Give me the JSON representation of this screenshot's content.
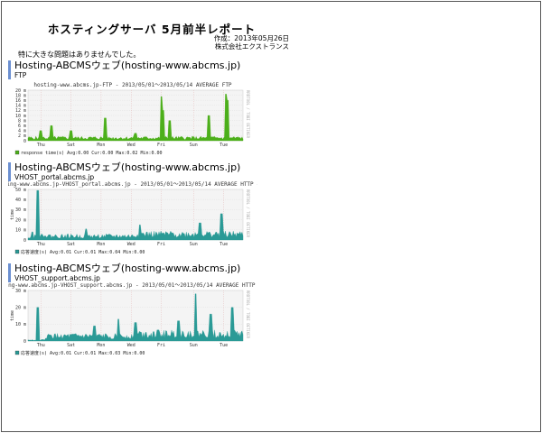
{
  "report": {
    "title": "ホスティングサーバ 5月前半レポート",
    "created_label": "作成：2013年05月26日",
    "company": "株式会社エクストランス",
    "note": "特に大きな問題はありませんでした。"
  },
  "sections": [
    {
      "title": "Hosting-ABCMSウェブ(hosting-www.abcms.jp)",
      "subtitle": "FTP"
    },
    {
      "title": "Hosting-ABCMSウェブ(hosting-www.abcms.jp)",
      "subtitle": "VHOST_portal.abcms.jp"
    },
    {
      "title": "Hosting-ABCMSウェブ(hosting-www.abcms.jp)",
      "subtitle": "VHOST_support.abcms.jp"
    }
  ],
  "chart_data": [
    {
      "type": "area",
      "title": "hosting-www.abcms.jp-FTP - 2013/05/01～2013/05/14 AVERAGE FTP",
      "ylabel": "",
      "yticks": [
        "20 m",
        "18 m",
        "16 m",
        "14 m",
        "12 m",
        "10 m",
        "8 m",
        "6 m",
        "4 m",
        "2 m",
        "0"
      ],
      "ylim": [
        0,
        0.02
      ],
      "xticks": [
        "Thu",
        "Sat",
        "Mon",
        "Wed",
        "Fri",
        "Sun",
        "Tue"
      ],
      "color": "#4caf1a",
      "series": [
        {
          "name": "response time(s)",
          "avg": "0.00",
          "cur": "0.00",
          "max": "0.02",
          "min": "0.00"
        }
      ],
      "legend_labels": {
        "avg": "Avg:",
        "cur": "Cur:",
        "max": "Max:",
        "min": "Min:"
      },
      "watermark": "RRDTOOL / TOBI OETIKER",
      "peaks": [
        [
          0.06,
          0.004
        ],
        [
          0.11,
          0.006
        ],
        [
          0.2,
          0.004
        ],
        [
          0.36,
          0.009
        ],
        [
          0.5,
          0.003
        ],
        [
          0.62,
          0.0175
        ],
        [
          0.63,
          0.012
        ],
        [
          0.66,
          0.008
        ],
        [
          0.84,
          0.01
        ],
        [
          0.92,
          0.0185
        ],
        [
          0.93,
          0.016
        ]
      ]
    },
    {
      "type": "area",
      "title": "ting-www.abcms.jp-VHOST_portal.abcms.jp - 2013/05/01～2013/05/14 AVERAGE HTTP ネ",
      "ylabel": "time",
      "yticks": [
        "50 m",
        "40 m",
        "30 m",
        "20 m",
        "10 m",
        "0"
      ],
      "ylim": [
        0,
        0.05
      ],
      "xticks": [
        "Thu",
        "Sat",
        "Mon",
        "Wed",
        "Fri",
        "Sun",
        "Tue"
      ],
      "color": "#2a9a96",
      "series": [
        {
          "name": "応答速度(s)",
          "avg": "0.01",
          "cur": "0.01",
          "max": "0.04",
          "min": "0.00"
        }
      ],
      "legend_labels": {
        "avg": "Avg:",
        "cur": "Cur:",
        "max": "Max:",
        "min": "Min:"
      },
      "watermark": "RRDTOOL / TOBI OETIKER",
      "peaks": [
        [
          0.02,
          0.008
        ],
        [
          0.045,
          0.049
        ],
        [
          0.08,
          0.004
        ],
        [
          0.27,
          0.011
        ],
        [
          0.52,
          0.015
        ],
        [
          0.8,
          0.017
        ],
        [
          0.9,
          0.026
        ]
      ]
    },
    {
      "type": "area",
      "title": "ting-www.abcms.jp-VHOST_support.abcms.jp - 2013/05/01～2013/05/14 AVERAGE HTTP ネ",
      "ylabel": "time",
      "yticks": [
        "30 m",
        "20 m",
        "10 m",
        "0"
      ],
      "ylim": [
        0,
        0.03
      ],
      "xticks": [
        "Thu",
        "Sat",
        "Mon",
        "Wed",
        "Fri",
        "Sun",
        "Tue"
      ],
      "color": "#2a9a96",
      "series": [
        {
          "name": "応答速度(s)",
          "avg": "0.01",
          "cur": "0.01",
          "max": "0.03",
          "min": "0.00"
        }
      ],
      "legend_labels": {
        "avg": "Avg:",
        "cur": "Cur:",
        "max": "Max:",
        "min": "Min:"
      },
      "watermark": "RRDTOOL / TOBI OETIKER",
      "peaks": [
        [
          0.045,
          0.02
        ],
        [
          0.31,
          0.009
        ],
        [
          0.42,
          0.013
        ],
        [
          0.5,
          0.011
        ],
        [
          0.7,
          0.012
        ],
        [
          0.78,
          0.028
        ],
        [
          0.85,
          0.016
        ],
        [
          0.95,
          0.02
        ]
      ]
    }
  ]
}
